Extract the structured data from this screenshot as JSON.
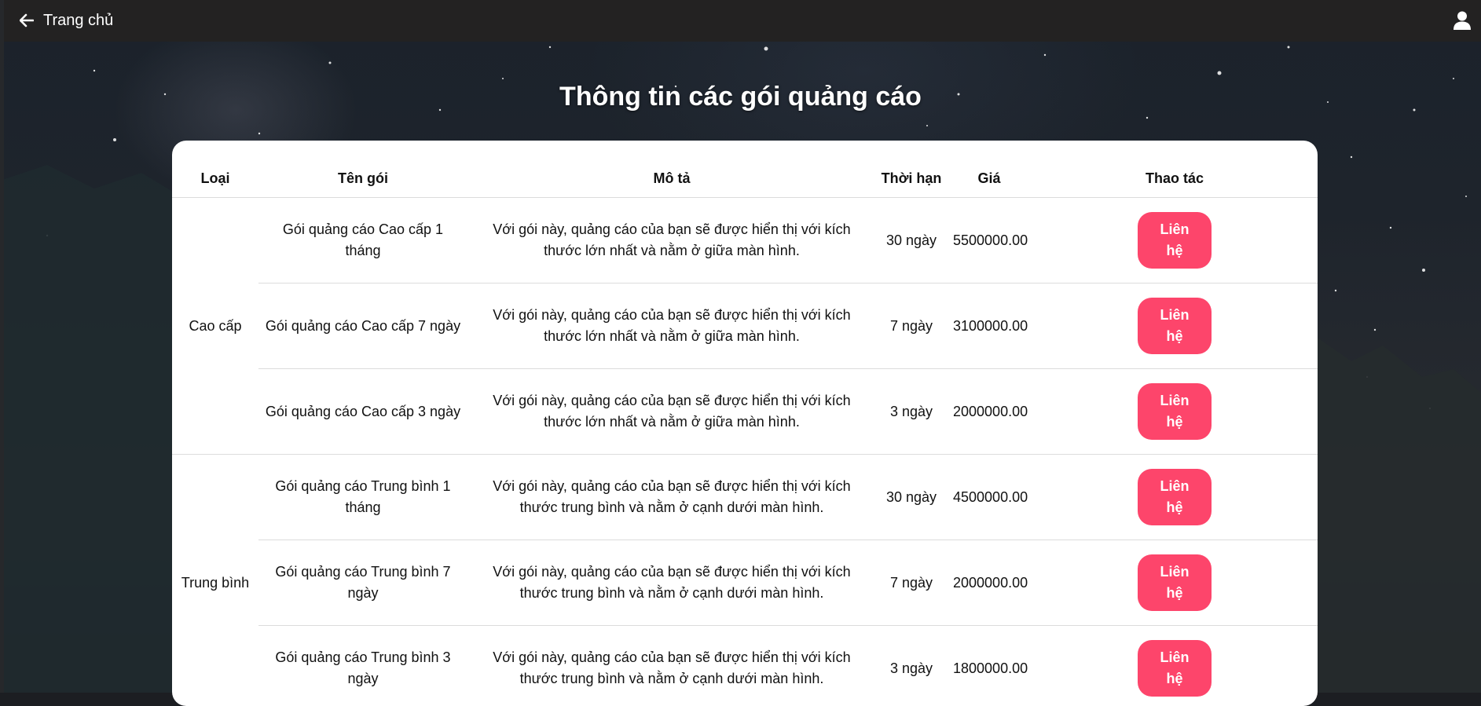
{
  "nav": {
    "back_label": "Trang chủ"
  },
  "page_title": "Thông tin các gói quảng cáo",
  "table": {
    "headers": {
      "type": "Loại",
      "name": "Tên gói",
      "description": "Mô tả",
      "duration": "Thời hạn",
      "price": "Giá",
      "action": "Thao tác"
    },
    "groups": [
      {
        "type": "Cao cấp",
        "rows": [
          {
            "name": "Gói quảng cáo Cao cấp 1 tháng",
            "description": "Với gói này, quảng cáo của bạn sẽ được hiển thị với kích thước lớn nhất và nằm ở giữa màn hình.",
            "duration": "30 ngày",
            "price": "5500000.00",
            "action": "Liên hệ"
          },
          {
            "name": "Gói quảng cáo Cao cấp 7 ngày",
            "description": "Với gói này, quảng cáo của bạn sẽ được hiển thị với kích thước lớn nhất và nằm ở giữa màn hình.",
            "duration": "7 ngày",
            "price": "3100000.00",
            "action": "Liên hệ"
          },
          {
            "name": "Gói quảng cáo Cao cấp 3 ngày",
            "description": "Với gói này, quảng cáo của bạn sẽ được hiển thị với kích thước lớn nhất và nằm ở giữa màn hình.",
            "duration": "3 ngày",
            "price": "2000000.00",
            "action": "Liên hệ"
          }
        ]
      },
      {
        "type": "Trung bình",
        "rows": [
          {
            "name": "Gói quảng cáo Trung bình 1 tháng",
            "description": "Với gói này, quảng cáo của bạn sẽ được hiển thị với kích thước trung bình và nằm ở cạnh dưới màn hình.",
            "duration": "30 ngày",
            "price": "4500000.00",
            "action": "Liên hệ"
          },
          {
            "name": "Gói quảng cáo Trung bình 7 ngày",
            "description": "Với gói này, quảng cáo của bạn sẽ được hiển thị với kích thước trung bình và nằm ở cạnh dưới màn hình.",
            "duration": "7 ngày",
            "price": "2000000.00",
            "action": "Liên hệ"
          },
          {
            "name": "Gói quảng cáo Trung bình 3 ngày",
            "description": "Với gói này, quảng cáo của bạn sẽ được hiển thị với kích thước trung bình và nằm ở cạnh dưới màn hình.",
            "duration": "3 ngày",
            "price": "1800000.00",
            "action": "Liên hệ"
          }
        ]
      }
    ]
  },
  "colors": {
    "topbar": "#232222",
    "accent_button": "#fd456b",
    "card": "#ffffff"
  },
  "icons": {
    "back": "arrow-left-icon",
    "user": "user-icon"
  }
}
